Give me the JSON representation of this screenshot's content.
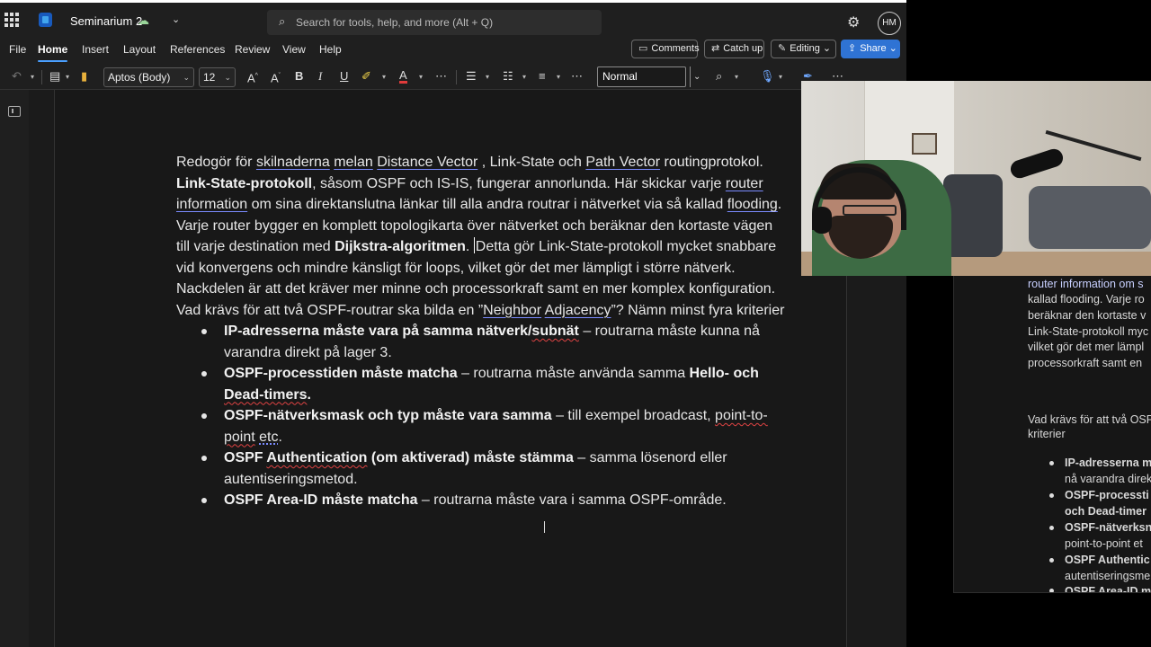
{
  "titlebar": {
    "doc_title": "Seminarium 2",
    "search_placeholder": "Search for tools, help, and more (Alt + Q)",
    "avatar_initials": "HM"
  },
  "menu": {
    "file": "File",
    "home": "Home",
    "insert": "Insert",
    "layout": "Layout",
    "references": "References",
    "review": "Review",
    "view": "View",
    "help": "Help"
  },
  "header_buttons": {
    "comments": "Comments",
    "catch_up": "Catch up",
    "editing": "Editing",
    "share": "Share"
  },
  "ribbon": {
    "font_name": "Aptos (Body)",
    "font_size": "12",
    "style": "Normal"
  },
  "document": {
    "q1_a": "Redogör för ",
    "q1_b": "skilnaderna",
    "q1_c": " ",
    "q1_d": "melan",
    "q1_e": " ",
    "q1_f": "Distance Vector",
    "q1_g": " , Link-State och ",
    "q1_h": "Path Vector",
    "q1_i": " routingprotokol.",
    "p1_bold": "Link-State-protokoll",
    "p1_a": ", såsom OSPF och IS-IS, fungerar annorlunda. Här skickar varje ",
    "p1_link": "router information",
    "p1_b": " om sina direktanslutna länkar till alla andra routrar i nätverket via så kallad ",
    "p1_flooding": "flooding",
    "p1_c": ". Varje router bygger en komplett topologikarta över nätverket och beräknar den kortaste vägen till varje destination med ",
    "p1_bold2": "Dijkstra-algoritmen",
    "p1_d": ". ",
    "p1_e": "Detta gör Link-State-protokoll mycket snabbare vid konvergens och mindre känsligt för loops, vilket gör det mer lämpligt i större nätverk. Nackdelen är att det kräver mer minne och processorkraft samt en mer komplex konfiguration.",
    "q2_a": "Vad krävs för att två OSPF-routrar ska bilda en ”",
    "q2_b": "Neighbor",
    "q2_c": " ",
    "q2_d": "Adjacency",
    "q2_e": "”? Nämn minst fyra kriterier",
    "b1_bold_a": "IP-adresserna måste vara på samma nätverk/",
    "b1_bold_b": "subnät",
    "b1_rest": " – routrarna måste kunna nå varandra direkt på lager 3.",
    "b2_bold": "OSPF-processtiden måste matcha",
    "b2_rest": " – routrarna måste använda samma ",
    "b2_bold2": "Hello- och ",
    "b2_bold3": "Dead-timers",
    "b2_end": ".",
    "b3_bold": "OSPF-nätverksmask och typ måste vara samma",
    "b3_rest": " – till exempel broadcast, ",
    "b3_p2p": "point-to-point",
    "b3_space": " ",
    "b3_etc": "etc",
    "b3_end": ".",
    "b4_bold_a": "OSPF ",
    "b4_bold_b": "Authentication",
    "b4_bold_c": " (om aktiverad) måste stämma",
    "b4_rest": " – samma lösenord eller autentiseringsmetod.",
    "b5_bold": "OSPF Area-ID måste matcha",
    "b5_rest": " – routrarna måste vara i samma OSPF-område."
  },
  "shadow_doc": {
    "l1": "router information om s",
    "l2": "kallad flooding. Varje ro",
    "l3": "beräknar den kortaste v",
    "l4": "Link-State-protokoll myc",
    "l5": "vilket gör det mer lämpl",
    "l6": "processorkraft samt en",
    "l7": "Vad krävs för att två OSP",
    "l8": "kriterier",
    "l9": "IP-adresserna m",
    "l10": "nå varandra direk",
    "l11": "OSPF-processti",
    "l12": "och Dead-timer",
    "l13": "OSPF-nätverksn",
    "l14": "point-to-point et",
    "l15": "OSPF Authentic",
    "l16": "autentiseringsme",
    "l17": "OSPF Area-ID m"
  },
  "icons": [
    "waffle-icon",
    "word-logo-icon",
    "cloud-sync-icon",
    "search-icon",
    "gear-icon",
    "comment-icon",
    "catch-up-icon",
    "pencil-icon",
    "share-icon",
    "undo-icon",
    "redo-icon",
    "paste-icon",
    "format-painter-icon",
    "grow-font-icon",
    "shrink-font-icon",
    "bold-icon",
    "italic-icon",
    "underline-icon",
    "highlight-icon",
    "font-color-icon",
    "more-icon",
    "bullets-icon",
    "numbering-icon",
    "align-icon",
    "find-icon",
    "dictate-icon",
    "designer-icon",
    "navigation-pane-icon"
  ]
}
